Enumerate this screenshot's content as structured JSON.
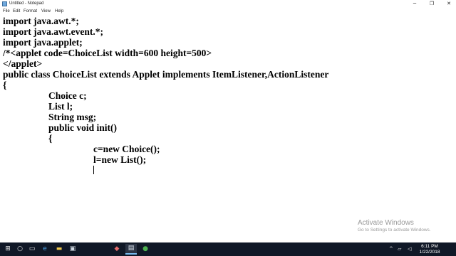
{
  "window": {
    "title": "Untitled - Notepad",
    "controls": {
      "minimize": "─",
      "maximize": "❐",
      "close": "✕"
    }
  },
  "menu": {
    "file": "File",
    "edit": "Edit",
    "format": "Format",
    "view": "View",
    "help": "Help"
  },
  "editor": {
    "lines": [
      "import java.awt.*;",
      "import java.awt.event.*;",
      "import java.applet;",
      "/*<applet code=ChoiceList width=600 height=500>",
      "</applet>",
      "public class ChoiceList extends Applet implements ItemListener,ActionListener",
      "{",
      "Choice c;",
      "List l;",
      "String msg;",
      "public void init()",
      "{",
      "c=new Choice();",
      "l=new List();"
    ]
  },
  "watermark": {
    "title": "Activate Windows",
    "subtitle": "Go to Settings to activate Windows."
  },
  "taskbar": {
    "icons": {
      "start": "⊞",
      "search": "○",
      "task_view": "▭",
      "edge": "e",
      "explorer": "▬",
      "store": "▣",
      "app1": "◆",
      "notepad": "▤",
      "app2": "●"
    },
    "tray": {
      "chevron": "^",
      "network": "▱",
      "volume": "◁",
      "time": "6:11 PM",
      "date": "1/22/2018"
    },
    "accent_color": "#76b9ed"
  }
}
